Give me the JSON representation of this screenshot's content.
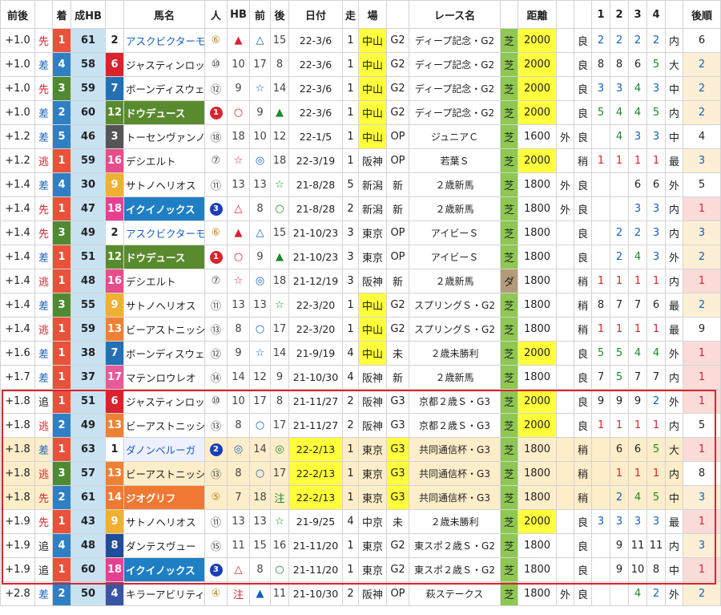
{
  "headers": [
    "前後",
    "",
    "着",
    "成HB",
    "",
    "馬名",
    "人",
    "HB",
    "前",
    "後",
    "日付",
    "走",
    "場",
    "",
    "レース名",
    "",
    "距離",
    "",
    "",
    "1",
    "2",
    "3",
    "4",
    "",
    "後順"
  ],
  "colors": {
    "pos_blue": "#c9e2f2",
    "pos_red": "#fadbd8",
    "yellow": "#ffff3c",
    "green_turf": "#8ec751",
    "brown_dirt": "#b39a7a",
    "orange_row": "#fdedc9",
    "blue_text": "#1560bd",
    "red_text": "#d9232e",
    "green_text": "#1a8a2a"
  },
  "rows": [
    {
      "diff": "+1.0",
      "style": "先",
      "rank": "1",
      "hb": "61",
      "gate": "2",
      "name": "アスクビクターモア",
      "pop": "⑥",
      "mark": "▲",
      "front": "△",
      "back": "15",
      "date": "22-3/6",
      "run": "1",
      "place": "中山",
      "grade": "G2",
      "race": "ディープ記念・G2",
      "surface": "芝",
      "dist": "2000",
      "ext": "",
      "cond": "良",
      "c1": "2",
      "c2": "2",
      "c3": "2",
      "c4": "2",
      "side": "内",
      "after": "6"
    },
    {
      "diff": "+1.0",
      "style": "差",
      "rank": "4",
      "hb": "58",
      "gate": "6",
      "name": "ジャスティンロック",
      "pop": "⑩",
      "mark": "10",
      "front": "17",
      "back": "8",
      "date": "22-3/6",
      "run": "1",
      "place": "中山",
      "grade": "G2",
      "race": "ディープ記念・G2",
      "surface": "芝",
      "dist": "2000",
      "ext": "",
      "cond": "良",
      "c1": "8",
      "c2": "8",
      "c3": "6",
      "c4": "5",
      "side": "大",
      "after": "2"
    },
    {
      "diff": "+1.0",
      "style": "先",
      "rank": "3",
      "hb": "59",
      "gate": "7",
      "name": "ボーンディスウェイ",
      "pop": "⑫",
      "mark": "9",
      "front": "☆",
      "back": "14",
      "date": "22-3/6",
      "run": "1",
      "place": "中山",
      "grade": "G2",
      "race": "ディープ記念・G2",
      "surface": "芝",
      "dist": "2000",
      "ext": "",
      "cond": "良",
      "c1": "3",
      "c2": "3",
      "c3": "4",
      "c4": "3",
      "side": "中",
      "after": "2"
    },
    {
      "diff": "+1.0",
      "style": "差",
      "rank": "2",
      "hb": "60",
      "gate": "12",
      "name": "ドウデュース",
      "pop": "1",
      "mark": "○",
      "front": "9",
      "back": "▲",
      "date": "22-3/6",
      "run": "1",
      "place": "中山",
      "grade": "G2",
      "race": "ディープ記念・G2",
      "surface": "芝",
      "dist": "2000",
      "ext": "",
      "cond": "良",
      "c1": "5",
      "c2": "4",
      "c3": "4",
      "c4": "5",
      "side": "内",
      "after": "2"
    },
    {
      "diff": "+1.2",
      "style": "差",
      "rank": "5",
      "hb": "46",
      "gate": "3",
      "name": "トーセンヴァンノ",
      "pop": "⑱",
      "mark": "18",
      "front": "10",
      "back": "12",
      "date": "22-1/5",
      "run": "1",
      "place": "中山",
      "grade": "OP",
      "race": "ジュニアＣ",
      "surface": "芝",
      "dist": "1600",
      "ext": "外",
      "cond": "良",
      "c1": "",
      "c2": "4",
      "c3": "3",
      "c4": "3",
      "side": "中",
      "after": "4"
    },
    {
      "diff": "+1.2",
      "style": "逃",
      "rank": "1",
      "hb": "59",
      "gate": "16",
      "name": "デシエルト",
      "pop": "⑦",
      "mark": "☆",
      "front": "◎",
      "back": "18",
      "date": "22-3/19",
      "run": "1",
      "place": "阪神",
      "grade": "OP",
      "race": "若葉Ｓ",
      "surface": "芝",
      "dist": "2000",
      "ext": "",
      "cond": "稍",
      "c1": "1",
      "c2": "1",
      "c3": "1",
      "c4": "1",
      "side": "最",
      "after": "3"
    },
    {
      "diff": "+1.4",
      "style": "差",
      "rank": "4",
      "hb": "30",
      "gate": "9",
      "name": "サトノヘリオス",
      "pop": "⑪",
      "mark": "13",
      "front": "13",
      "back": "☆",
      "date": "21-8/28",
      "run": "5",
      "place": "新潟",
      "grade": "新",
      "race": "２歳新馬",
      "surface": "芝",
      "dist": "1800",
      "ext": "外",
      "cond": "良",
      "c1": "",
      "c2": "",
      "c3": "6",
      "c4": "6",
      "side": "外",
      "after": "5"
    },
    {
      "diff": "+1.4",
      "style": "先",
      "rank": "1",
      "hb": "47",
      "gate": "18",
      "name": "イクイノックス",
      "pop": "3",
      "mark": "△",
      "front": "8",
      "back": "○",
      "date": "21-8/28",
      "run": "2",
      "place": "新潟",
      "grade": "新",
      "race": "２歳新馬",
      "surface": "芝",
      "dist": "1800",
      "ext": "外",
      "cond": "良",
      "c1": "",
      "c2": "",
      "c3": "3",
      "c4": "3",
      "side": "内",
      "after": "1"
    },
    {
      "diff": "+1.4",
      "style": "先",
      "rank": "3",
      "hb": "49",
      "gate": "2",
      "name": "アスクビクターモア",
      "pop": "⑥",
      "mark": "▲",
      "front": "△",
      "back": "15",
      "date": "21-10/23",
      "run": "3",
      "place": "東京",
      "grade": "OP",
      "race": "アイビーＳ",
      "surface": "芝",
      "dist": "1800",
      "ext": "",
      "cond": "良",
      "c1": "",
      "c2": "2",
      "c3": "2",
      "c4": "3",
      "side": "内",
      "after": "3"
    },
    {
      "diff": "+1.4",
      "style": "差",
      "rank": "1",
      "hb": "51",
      "gate": "12",
      "name": "ドウデュース",
      "pop": "1",
      "mark": "○",
      "front": "9",
      "back": "▲",
      "date": "21-10/23",
      "run": "3",
      "place": "東京",
      "grade": "OP",
      "race": "アイビーＳ",
      "surface": "芝",
      "dist": "1800",
      "ext": "",
      "cond": "良",
      "c1": "",
      "c2": "2",
      "c3": "4",
      "c4": "3",
      "side": "外",
      "after": "2"
    },
    {
      "diff": "+1.4",
      "style": "逃",
      "rank": "1",
      "hb": "48",
      "gate": "16",
      "name": "デシエルト",
      "pop": "⑦",
      "mark": "☆",
      "front": "◎",
      "back": "18",
      "date": "21-12/19",
      "run": "3",
      "place": "阪神",
      "grade": "新",
      "race": "２歳新馬",
      "surface": "ダ",
      "dist": "1800",
      "ext": "",
      "cond": "稍",
      "c1": "1",
      "c2": "1",
      "c3": "1",
      "c4": "1",
      "side": "内",
      "after": "1"
    },
    {
      "diff": "+1.4",
      "style": "差",
      "rank": "3",
      "hb": "55",
      "gate": "9",
      "name": "サトノヘリオス",
      "pop": "⑪",
      "mark": "13",
      "front": "13",
      "back": "☆",
      "date": "22-3/20",
      "run": "1",
      "place": "中山",
      "grade": "G2",
      "race": "スプリングＳ・G2",
      "surface": "芝",
      "dist": "1800",
      "ext": "",
      "cond": "稍",
      "c1": "8",
      "c2": "7",
      "c3": "7",
      "c4": "6",
      "side": "最",
      "after": "2"
    },
    {
      "diff": "+1.4",
      "style": "逃",
      "rank": "1",
      "hb": "59",
      "gate": "13",
      "name": "ビーアストニッシド",
      "pop": "⑬",
      "mark": "8",
      "front": "○",
      "back": "17",
      "date": "22-3/20",
      "run": "1",
      "place": "中山",
      "grade": "G2",
      "race": "スプリングＳ・G2",
      "surface": "芝",
      "dist": "1800",
      "ext": "",
      "cond": "稍",
      "c1": "1",
      "c2": "1",
      "c3": "1",
      "c4": "1",
      "side": "最",
      "after": "9"
    },
    {
      "diff": "+1.6",
      "style": "差",
      "rank": "1",
      "hb": "38",
      "gate": "7",
      "name": "ボーンディスウェイ",
      "pop": "⑫",
      "mark": "9",
      "front": "☆",
      "back": "14",
      "date": "21-9/19",
      "run": "4",
      "place": "中山",
      "grade": "未",
      "race": "２歳未勝利",
      "surface": "芝",
      "dist": "2000",
      "ext": "",
      "cond": "良",
      "c1": "5",
      "c2": "5",
      "c3": "4",
      "c4": "4",
      "side": "外",
      "after": "1"
    },
    {
      "diff": "+1.7",
      "style": "差",
      "rank": "1",
      "hb": "37",
      "gate": "17",
      "name": "マテンロウレオ",
      "pop": "⑭",
      "mark": "14",
      "front": "12",
      "back": "9",
      "date": "21-10/30",
      "run": "4",
      "place": "阪神",
      "grade": "新",
      "race": "２歳新馬",
      "surface": "芝",
      "dist": "1800",
      "ext": "",
      "cond": "良",
      "c1": "7",
      "c2": "5",
      "c3": "7",
      "c4": "7",
      "side": "内",
      "after": "1"
    },
    {
      "diff": "+1.8",
      "style": "追",
      "rank": "1",
      "hb": "51",
      "gate": "6",
      "name": "ジャスティンロック",
      "pop": "⑩",
      "mark": "10",
      "front": "17",
      "back": "8",
      "date": "21-11/27",
      "run": "2",
      "place": "阪神",
      "grade": "G3",
      "race": "京都２歳Ｓ・G3",
      "surface": "芝",
      "dist": "2000",
      "ext": "",
      "cond": "良",
      "c1": "9",
      "c2": "9",
      "c3": "9",
      "c4": "2",
      "side": "外",
      "after": "1"
    },
    {
      "diff": "+1.8",
      "style": "逃",
      "rank": "2",
      "hb": "49",
      "gate": "13",
      "name": "ビーアストニッシド",
      "pop": "⑬",
      "mark": "8",
      "front": "○",
      "back": "17",
      "date": "21-11/27",
      "run": "2",
      "place": "阪神",
      "grade": "G3",
      "race": "京都２歳Ｓ・G3",
      "surface": "芝",
      "dist": "2000",
      "ext": "",
      "cond": "良",
      "c1": "1",
      "c2": "1",
      "c3": "1",
      "c4": "1",
      "side": "内",
      "after": "5"
    },
    {
      "diff": "+1.8",
      "style": "差",
      "rank": "1",
      "hb": "63",
      "gate": "1",
      "name": "ダノンベルーガ",
      "pop": "2",
      "mark": "◎",
      "front": "14",
      "back": "◎",
      "date": "22-2/13",
      "run": "1",
      "place": "東京",
      "grade": "G3",
      "race": "共同通信杯・G3",
      "surface": "芝",
      "dist": "1800",
      "ext": "",
      "cond": "稍",
      "c1": "",
      "c2": "6",
      "c3": "6",
      "c4": "5",
      "side": "大",
      "after": "1"
    },
    {
      "diff": "+1.8",
      "style": "逃",
      "rank": "3",
      "hb": "57",
      "gate": "13",
      "name": "ビーアストニッシド",
      "pop": "⑬",
      "mark": "8",
      "front": "○",
      "back": "17",
      "date": "22-2/13",
      "run": "1",
      "place": "東京",
      "grade": "G3",
      "race": "共同通信杯・G3",
      "surface": "芝",
      "dist": "1800",
      "ext": "",
      "cond": "稍",
      "c1": "",
      "c2": "1",
      "c3": "1",
      "c4": "1",
      "side": "内",
      "after": "8"
    },
    {
      "diff": "+1.8",
      "style": "先",
      "rank": "2",
      "hb": "61",
      "gate": "14",
      "name": "ジオグリフ",
      "pop": "⑤",
      "mark": "7",
      "front": "18",
      "back": "注",
      "date": "22-2/13",
      "run": "1",
      "place": "東京",
      "grade": "G3",
      "race": "共同通信杯・G3",
      "surface": "芝",
      "dist": "1800",
      "ext": "",
      "cond": "稍",
      "c1": "",
      "c2": "2",
      "c3": "4",
      "c4": "5",
      "side": "中",
      "after": "3"
    },
    {
      "diff": "+1.9",
      "style": "先",
      "rank": "1",
      "hb": "43",
      "gate": "9",
      "name": "サトノヘリオス",
      "pop": "⑪",
      "mark": "13",
      "front": "13",
      "back": "☆",
      "date": "21-9/25",
      "run": "4",
      "place": "中京",
      "grade": "未",
      "race": "２歳未勝利",
      "surface": "芝",
      "dist": "2000",
      "ext": "",
      "cond": "良",
      "c1": "3",
      "c2": "3",
      "c3": "3",
      "c4": "3",
      "side": "最",
      "after": "1"
    },
    {
      "diff": "+1.9",
      "style": "追",
      "rank": "4",
      "hb": "48",
      "gate": "8",
      "name": "ダンテスヴュー",
      "pop": "⑮",
      "mark": "11",
      "front": "15",
      "back": "16",
      "date": "21-11/20",
      "run": "1",
      "place": "東京",
      "grade": "G2",
      "race": "東スポ２歳Ｓ・G2",
      "surface": "芝",
      "dist": "1800",
      "ext": "",
      "cond": "良",
      "c1": "",
      "c2": "9",
      "c3": "11",
      "c4": "11",
      "side": "内",
      "after": "3"
    },
    {
      "diff": "+1.9",
      "style": "追",
      "rank": "1",
      "hb": "60",
      "gate": "18",
      "name": "イクイノックス",
      "pop": "3",
      "mark": "△",
      "front": "8",
      "back": "○",
      "date": "21-11/20",
      "run": "1",
      "place": "東京",
      "grade": "G2",
      "race": "東スポ２歳Ｓ・G2",
      "surface": "芝",
      "dist": "1800",
      "ext": "",
      "cond": "良",
      "c1": "",
      "c2": "9",
      "c3": "10",
      "c4": "8",
      "side": "中",
      "after": "1"
    },
    {
      "diff": "+2.8",
      "style": "差",
      "rank": "2",
      "hb": "50",
      "gate": "4",
      "name": "キラーアビリティ",
      "pop": "④",
      "mark": "注",
      "front": "▲",
      "back": "11",
      "date": "21-10/30",
      "run": "2",
      "place": "阪神",
      "grade": "OP",
      "race": "萩ステークス",
      "surface": "芝",
      "dist": "1800",
      "ext": "外",
      "cond": "良",
      "c1": "",
      "c2": "",
      "c3": "4",
      "c4": "2",
      "side": "外",
      "after": "2"
    }
  ]
}
